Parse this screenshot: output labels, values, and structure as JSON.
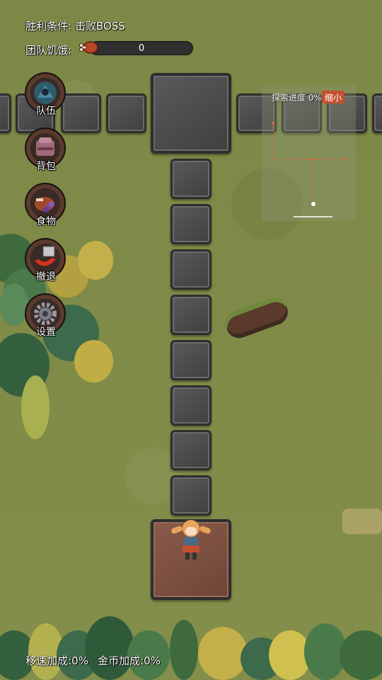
{
  "hud": {
    "victory_condition": "胜利条件: 击败BOSS",
    "hunger_label": "团队饥饿:",
    "hunger_value": "0",
    "hunger_icon": "meat-icon"
  },
  "menu": [
    {
      "label": "队伍",
      "icon": "team-icon"
    },
    {
      "label": "背包",
      "icon": "backpack-icon"
    },
    {
      "label": "食物",
      "icon": "food-icon"
    },
    {
      "label": "撤退",
      "icon": "retreat-icon"
    },
    {
      "label": "设置",
      "icon": "settings-icon"
    }
  ],
  "minimap": {
    "progress_label": "探索进度 0%",
    "shrink_button": "缩小",
    "accent_color": "#c4502e"
  },
  "footer": {
    "speed_bonus": "移速加成:0%",
    "gold_bonus": "金币加成:0%"
  }
}
